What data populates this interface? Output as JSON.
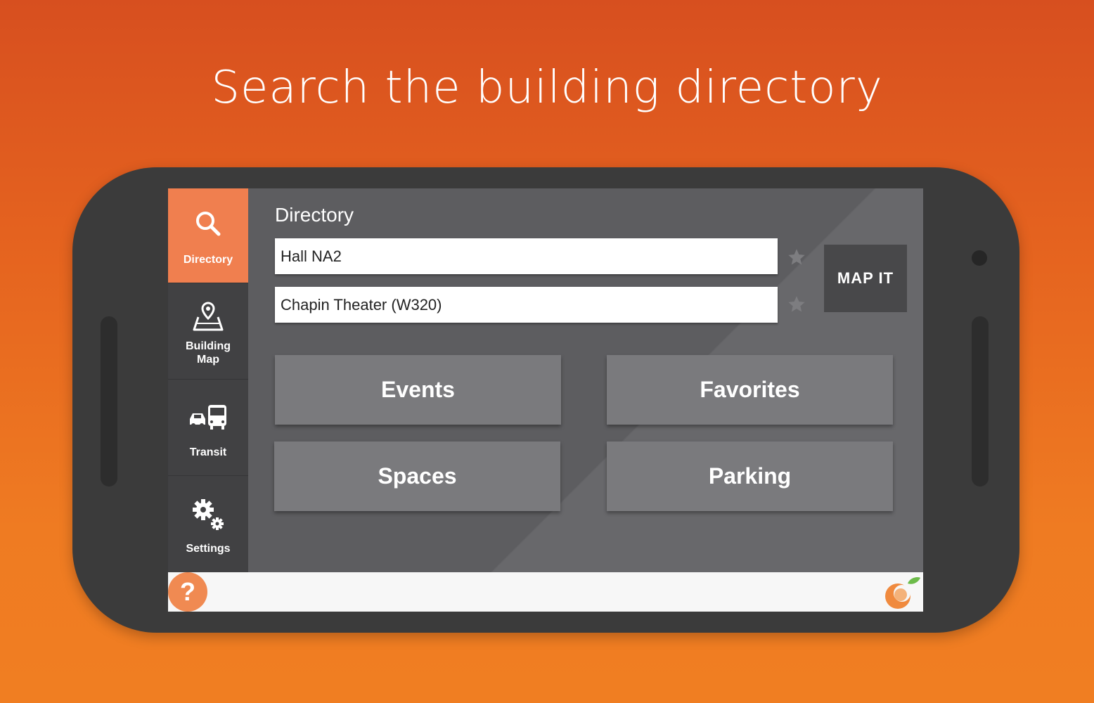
{
  "headline": "Search the building directory",
  "sidebar": {
    "items": [
      {
        "label": "Directory",
        "icon": "search-icon",
        "active": true
      },
      {
        "label_line1": "Building",
        "label_line2": "Map",
        "icon": "map-pin-icon",
        "active": false
      },
      {
        "label": "Transit",
        "icon": "transit-icon",
        "active": false
      },
      {
        "label": "Settings",
        "icon": "gear-icon",
        "active": false
      }
    ]
  },
  "main": {
    "title": "Directory",
    "from_field": {
      "value": "Hall NA2"
    },
    "to_field": {
      "value": "Chapin Theater (W320)"
    },
    "map_it_label": "MAP IT",
    "tiles": {
      "events": "Events",
      "favorites": "Favorites",
      "spaces": "Spaces",
      "parking": "Parking"
    }
  },
  "bottom_bar": {
    "help_label": "?",
    "logo_icon": "orange-logo-icon"
  },
  "colors": {
    "background_top": "#d74f1f",
    "background_bottom": "#f07e22",
    "accent": "#f07f4f",
    "sidebar": "#414143",
    "screen": "#5d5d60",
    "tile": "#7a7a7d"
  }
}
